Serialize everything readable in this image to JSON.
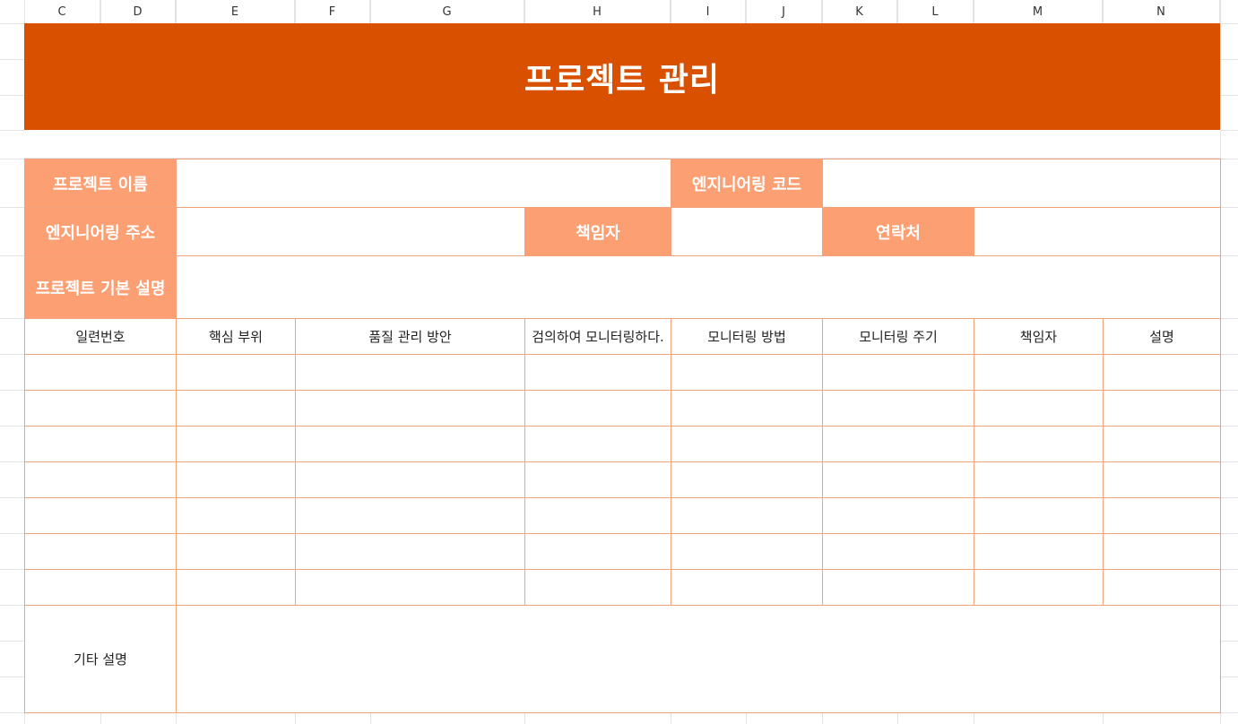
{
  "columns": [
    {
      "label": "C"
    },
    {
      "label": "D"
    },
    {
      "label": "E"
    },
    {
      "label": "F"
    },
    {
      "label": "G"
    },
    {
      "label": "H"
    },
    {
      "label": "I"
    },
    {
      "label": "J"
    },
    {
      "label": "K"
    },
    {
      "label": "L"
    },
    {
      "label": "M"
    },
    {
      "label": "N"
    }
  ],
  "title": "프로젝트 관리",
  "info": {
    "project_name": "프로젝트 이름",
    "engineering_code": "엔지니어링 코드",
    "engineering_address": "엔지니어링 주소",
    "responsible": "책임자",
    "contact": "연락처",
    "project_description": "프로젝트 기본 설명"
  },
  "table": {
    "headers": [
      "일련번호",
      "핵심 부위",
      "품질 관리 방안",
      "검의하여 모니터링하다.",
      "모니터링 방법",
      "모니터링 주기",
      "책임자",
      "설명"
    ],
    "empty_rows": 7
  },
  "other_notes_label": "기타 설명",
  "colors": {
    "title_band": "#d95000",
    "label_fill": "#fca074",
    "border": "#f2a37c"
  }
}
